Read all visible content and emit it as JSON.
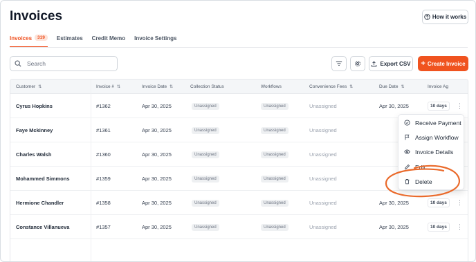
{
  "page": {
    "title": "Invoices"
  },
  "help_button": {
    "label": "How it works"
  },
  "tabs": [
    {
      "label": "Invoices",
      "badge": "319",
      "active": true
    },
    {
      "label": "Estimates"
    },
    {
      "label": "Credit Memo"
    },
    {
      "label": "Invoice Settings"
    }
  ],
  "search": {
    "placeholder": "Search",
    "value": ""
  },
  "toolbar": {
    "filter_icon": "filter-icon",
    "settings_icon": "gear-icon",
    "export_label": "Export CSV",
    "create_label": "Create Invoice"
  },
  "colors": {
    "accent": "#f0531f",
    "annotation": "#ea6a2b"
  },
  "table": {
    "columns": [
      "Customer",
      "Invoice #",
      "Invoice Date",
      "Collection Status",
      "Workflows",
      "Convenience Fees",
      "Due Date",
      "Invoice Ag"
    ],
    "rows": [
      {
        "customer": "Cyrus Hopkins",
        "invoice": "#1362",
        "date": "Apr 30, 2025",
        "status": "Unassigned",
        "workflow": "Unassigned",
        "fees": "Unassigned",
        "due": "Apr 30, 2025",
        "age": "10 days"
      },
      {
        "customer": "Faye Mckinney",
        "invoice": "#1361",
        "date": "Apr 30, 2025",
        "status": "Unassigned",
        "workflow": "Unassigned",
        "fees": "Unassigned",
        "due": "",
        "age": ""
      },
      {
        "customer": "Charles Walsh",
        "invoice": "#1360",
        "date": "Apr 30, 2025",
        "status": "Unassigned",
        "workflow": "Unassigned",
        "fees": "Unassigned",
        "due": "",
        "age": ""
      },
      {
        "customer": "Mohammed Simmons",
        "invoice": "#1359",
        "date": "Apr 30, 2025",
        "status": "Unassigned",
        "workflow": "Unassigned",
        "fees": "Unassigned",
        "due": "",
        "age": ""
      },
      {
        "customer": "Hermione Chandler",
        "invoice": "#1358",
        "date": "Apr 30, 2025",
        "status": "Unassigned",
        "workflow": "Unassigned",
        "fees": "Unassigned",
        "due": "Apr 30, 2025",
        "age": "10 days"
      },
      {
        "customer": "Constance Villanueva",
        "invoice": "#1357",
        "date": "Apr 30, 2025",
        "status": "Unassigned",
        "workflow": "Unassigned",
        "fees": "Unassigned",
        "due": "Apr 30, 2025",
        "age": "10 days"
      }
    ]
  },
  "row_menu": {
    "items": [
      {
        "label": "Receive Payment",
        "icon": "check-circle-icon"
      },
      {
        "label": "Assign Workflow",
        "icon": "flag-icon"
      },
      {
        "label": "Invoice Details",
        "icon": "eye-icon"
      },
      {
        "label": "Edit",
        "icon": "pencil-icon"
      },
      {
        "label": "Delete",
        "icon": "trash-icon"
      }
    ]
  }
}
